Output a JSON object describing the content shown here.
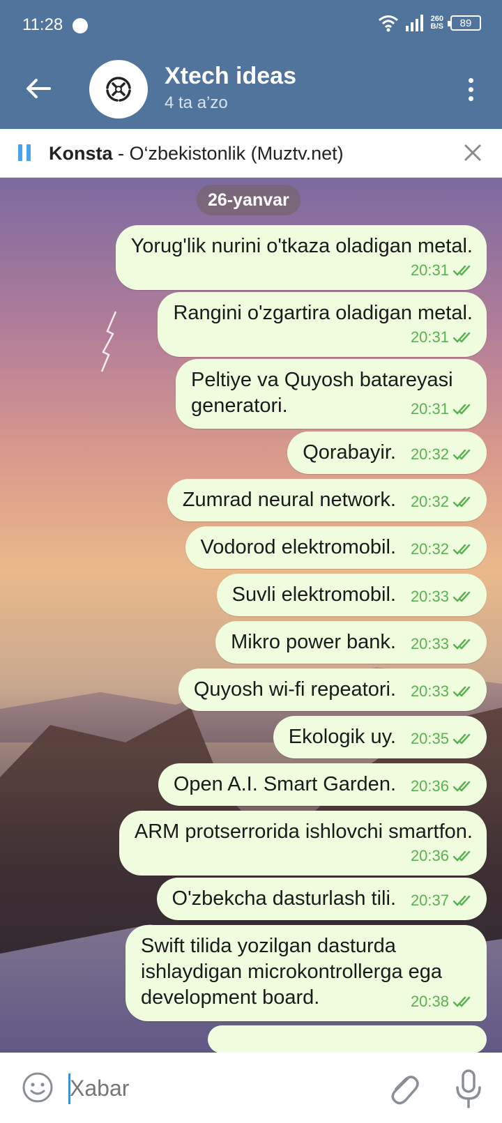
{
  "status_bar": {
    "time": "11:28",
    "speed_value": "260",
    "speed_unit": "B/S",
    "battery": "89"
  },
  "header": {
    "title": "Xtech ideas",
    "subtitle": "4 ta a’zo"
  },
  "player": {
    "artist": "Konsta",
    "separator": " - ",
    "track": "O‘zbekistonlik (Muztv.net)"
  },
  "chat": {
    "date_label": "26-yanvar",
    "messages": [
      {
        "text": "Yorug'lik nurini o'tkaza oladigan metal.",
        "time": "20:31"
      },
      {
        "text": "Rangini o'zgartira oladigan metal.",
        "time": "20:31"
      },
      {
        "line1": "Peltiye va Quyosh batareyasi",
        "line2": "generatori.",
        "time": "20:31"
      },
      {
        "text": "Qorabayir.",
        "time": "20:32"
      },
      {
        "text": "Zumrad neural network.",
        "time": "20:32"
      },
      {
        "text": "Vodorod elektromobil.",
        "time": "20:32"
      },
      {
        "text": "Suvli elektromobil.",
        "time": "20:33"
      },
      {
        "text": "Mikro power bank.",
        "time": "20:33"
      },
      {
        "text": "Quyosh wi-fi repeatori.",
        "time": "20:33"
      },
      {
        "text": "Ekologik uy.",
        "time": "20:35"
      },
      {
        "text": "Open A.I. Smart Garden.",
        "time": "20:36"
      },
      {
        "text": "ARM protserrorida ishlovchi smartfon.",
        "time": "20:36"
      },
      {
        "text": "O'zbekcha dasturlash tili.",
        "time": "20:37"
      },
      {
        "line1": "Swift tilida yozilgan dasturda",
        "line2": "ishlaydigan microkontrollerga ega",
        "line3": "development board.",
        "time": "20:38"
      }
    ]
  },
  "input": {
    "placeholder": "Xabar"
  },
  "colors": {
    "header_bg": "#51749c",
    "bubble_bg": "#effdde",
    "read_check": "#5bb152",
    "pause_accent": "#4aa3e8"
  },
  "icons": [
    "wifi-icon",
    "signal-icon",
    "back-arrow-icon",
    "group-logo-icon",
    "more-vert-icon",
    "pause-icon",
    "close-icon",
    "double-check-icon",
    "emoji-icon",
    "attach-icon",
    "mic-icon"
  ]
}
